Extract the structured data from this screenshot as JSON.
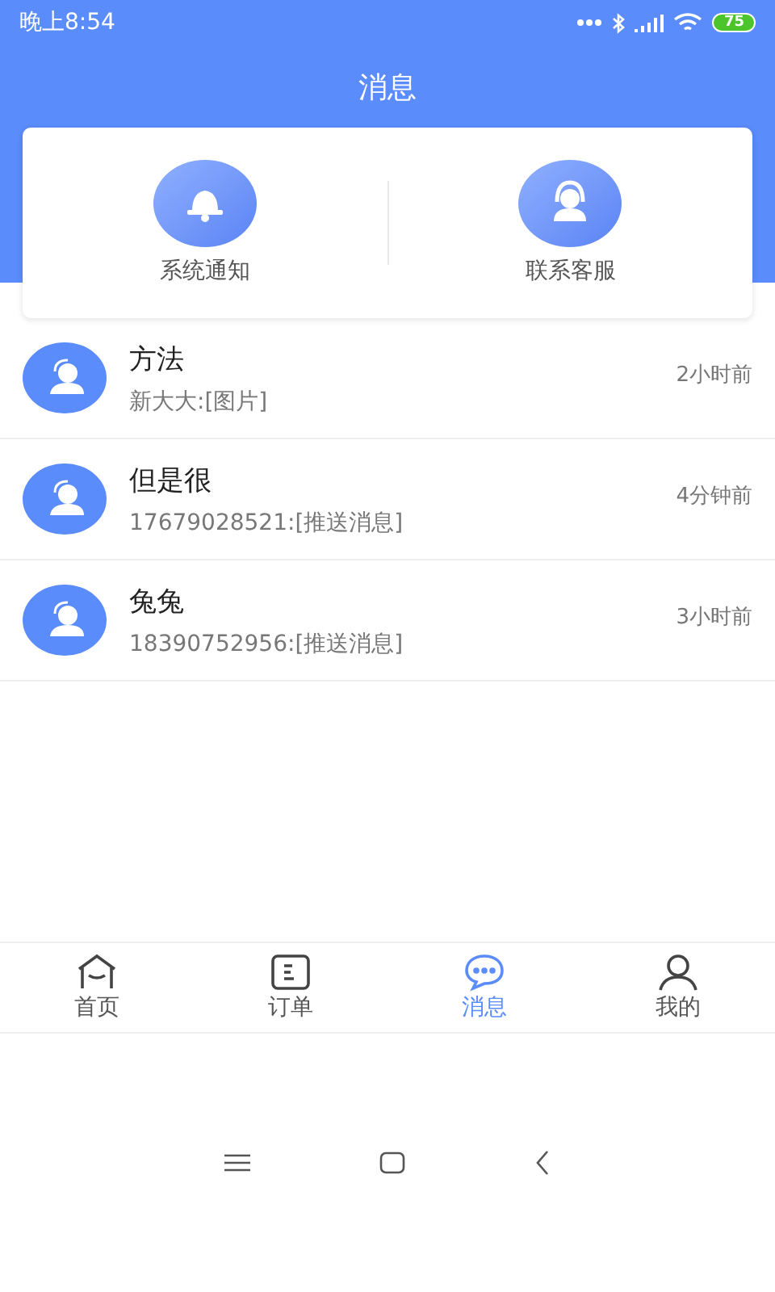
{
  "status_bar": {
    "time": "晚上8:54",
    "battery": "75"
  },
  "header": {
    "title": "消息"
  },
  "shortcuts": [
    {
      "kind": "bell",
      "label": "系统通知"
    },
    {
      "kind": "headset",
      "label": "联系客服"
    }
  ],
  "conversations": [
    {
      "name": "方法",
      "preview": "新大大:[图片]",
      "time": "2小时前"
    },
    {
      "name": "但是很",
      "preview": "17679028521:[推送消息]",
      "time": "4分钟前"
    },
    {
      "name": "兔兔",
      "preview": "18390752956:[推送消息]",
      "time": "3小时前"
    }
  ],
  "tabs": [
    {
      "kind": "home",
      "label": "首页",
      "selected": false
    },
    {
      "kind": "order",
      "label": "订单",
      "selected": false
    },
    {
      "kind": "message",
      "label": "消息",
      "selected": true
    },
    {
      "kind": "profile",
      "label": "我的",
      "selected": false
    }
  ]
}
